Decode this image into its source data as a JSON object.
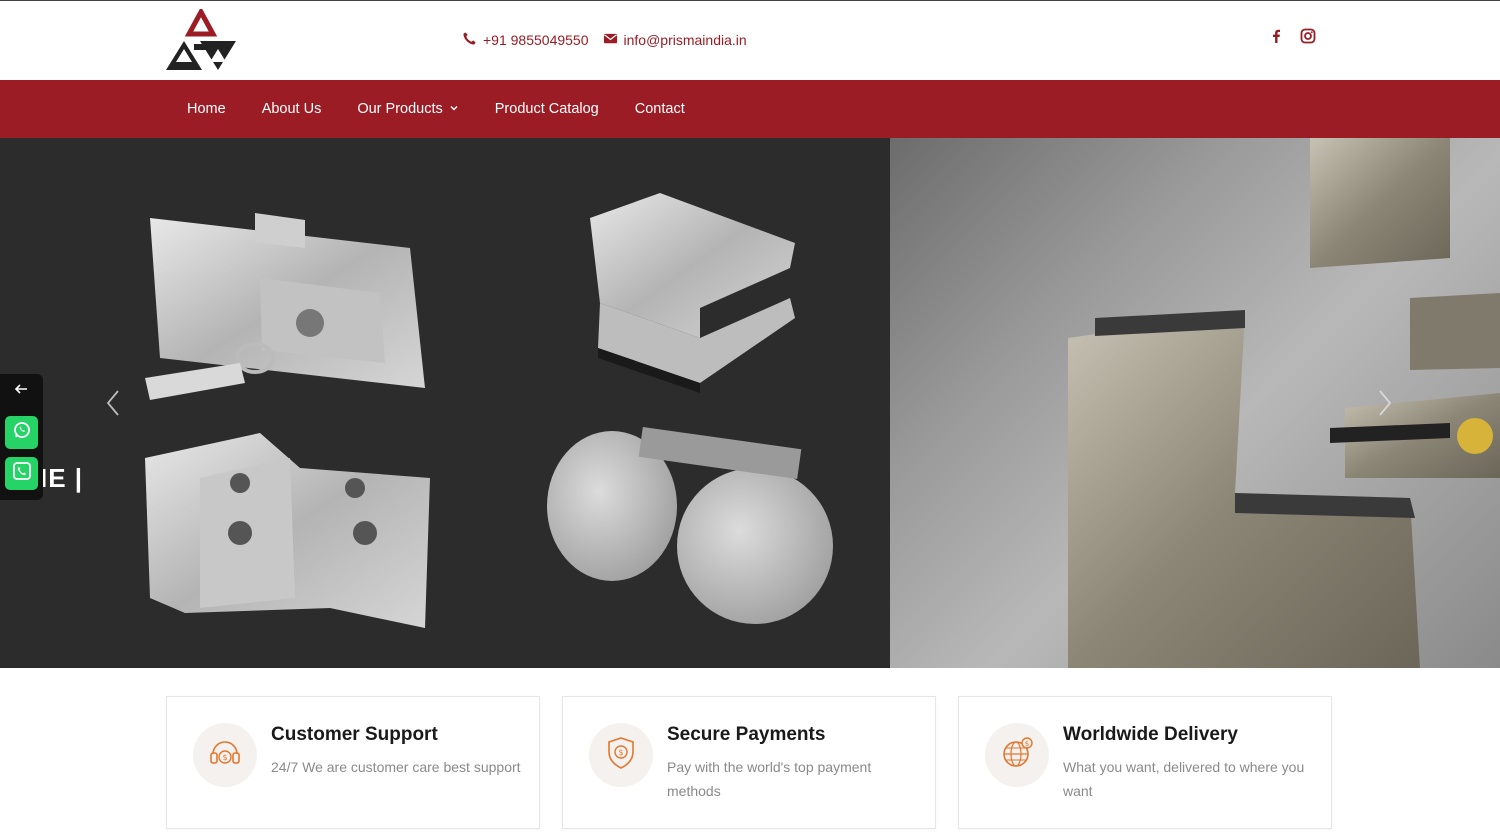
{
  "header": {
    "phone": "+91 9855049550",
    "email": "info@prismaindia.in",
    "social": [
      "facebook-icon",
      "instagram-icon"
    ]
  },
  "nav": {
    "items": [
      {
        "label": "Home"
      },
      {
        "label": "About Us"
      },
      {
        "label": "Our Products"
      },
      {
        "label": "Product Catalog"
      },
      {
        "label": "Contact"
      }
    ]
  },
  "hero": {
    "partial_text": "IE |"
  },
  "features": [
    {
      "title": "Customer Support",
      "description": "24/7 We are customer care best support",
      "icon": "headset-icon"
    },
    {
      "title": "Secure Payments",
      "description": "Pay with the world's top payment methods",
      "icon": "shield-dollar-icon"
    },
    {
      "title": "Worldwide Delivery",
      "description": "What you want, delivered to where you want",
      "icon": "globe-icon"
    }
  ],
  "colors": {
    "brand": "#9b1c25",
    "accent": "#e4772f",
    "whatsapp": "#25d366"
  }
}
